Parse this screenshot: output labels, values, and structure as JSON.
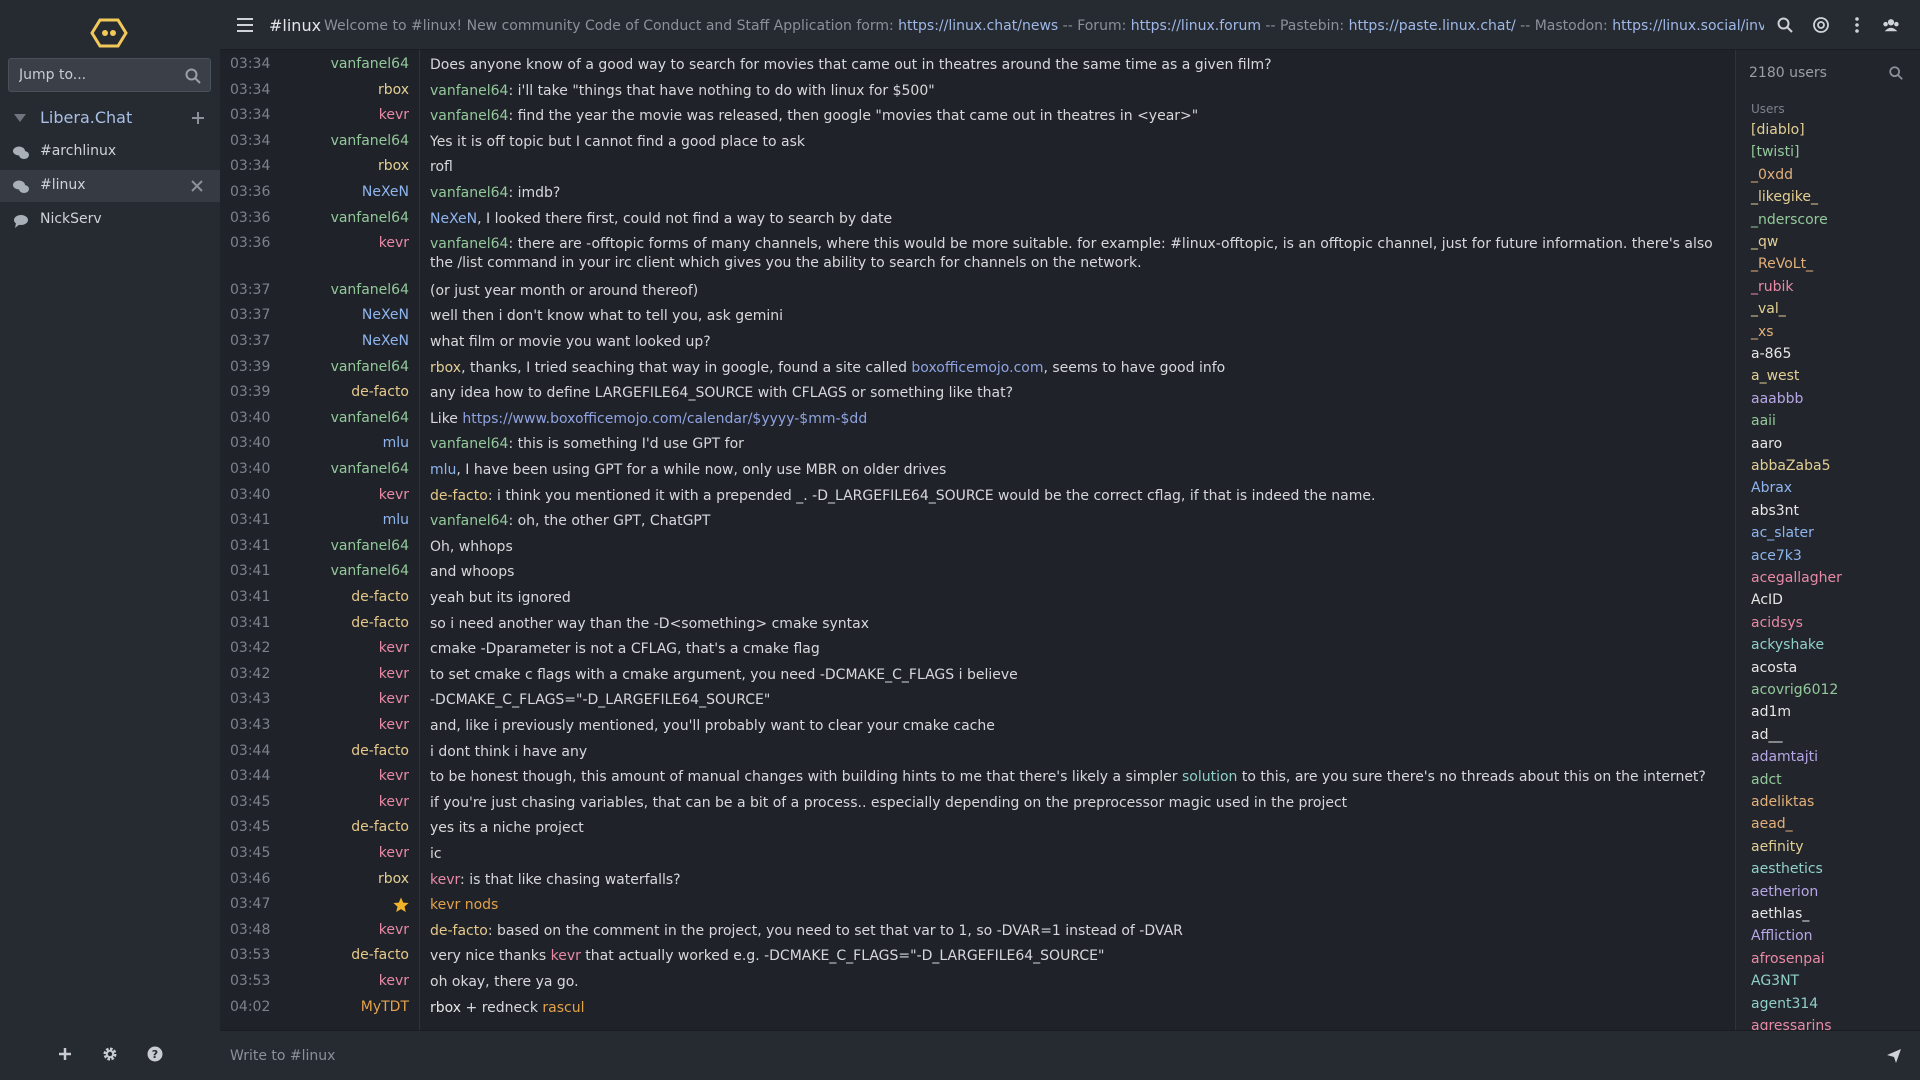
{
  "sidebar": {
    "jump_placeholder": "Jump to...",
    "network_name": "Libera.Chat",
    "channels": [
      {
        "label": "#archlinux"
      },
      {
        "label": "#linux",
        "active": true
      },
      {
        "label": "NickServ"
      }
    ]
  },
  "header": {
    "channel": "#linux",
    "topic_parts": [
      {
        "text": "Welcome to #linux! New community Code of Conduct and Staff Application form: ",
        "link": false
      },
      {
        "text": "https://linux.chat/news",
        "link": true
      },
      {
        "text": " -- Forum: ",
        "link": false
      },
      {
        "text": "https://linux.forum",
        "link": true
      },
      {
        "text": " -- Pastebin: ",
        "link": false
      },
      {
        "text": "https://paste.linux.chat/",
        "link": true
      },
      {
        "text": " -- Mastodon: ",
        "link": false
      },
      {
        "text": "https://linux.social/inv",
        "link": true
      }
    ]
  },
  "messages": [
    {
      "time": "03:34",
      "nick": "vanfanel64",
      "nc": "c-v",
      "parts": [
        {
          "text": "Does anyone know of a good way to search for movies that came out in theatres around the same time as a given film?"
        }
      ]
    },
    {
      "time": "03:34",
      "nick": "rbox",
      "nc": "c-r",
      "parts": [
        {
          "text": "vanfanel64",
          "c": "c-v"
        },
        {
          "text": ": i'll take \"things that have nothing to do with linux for $500\""
        }
      ]
    },
    {
      "time": "03:34",
      "nick": "kevr",
      "nc": "c-k",
      "parts": [
        {
          "text": "vanfanel64",
          "c": "c-v"
        },
        {
          "text": ": find the year the movie was released, then google \"movies that came out in theatres in <year>\""
        }
      ]
    },
    {
      "time": "03:34",
      "nick": "vanfanel64",
      "nc": "c-v",
      "parts": [
        {
          "text": "Yes it is off topic but I cannot find a good place to ask"
        }
      ]
    },
    {
      "time": "03:34",
      "nick": "rbox",
      "nc": "c-r",
      "parts": [
        {
          "text": "rofl"
        }
      ]
    },
    {
      "time": "03:36",
      "nick": "NeXeN",
      "nc": "c-n",
      "parts": [
        {
          "text": "vanfanel64",
          "c": "c-v"
        },
        {
          "text": ": imdb?"
        }
      ]
    },
    {
      "time": "03:36",
      "nick": "vanfanel64",
      "nc": "c-v",
      "parts": [
        {
          "text": "NeXeN",
          "c": "c-n"
        },
        {
          "text": ", I looked there first, could not find a way to search by date"
        }
      ]
    },
    {
      "time": "03:36",
      "nick": "kevr",
      "nc": "c-k",
      "lines": 2,
      "parts": [
        {
          "text": "vanfanel64",
          "c": "c-v"
        },
        {
          "text": ": there are -offtopic forms of many channels, where this would be more suitable. for example: #linux-offtopic, is an offtopic channel, just for future information. there's also the /list command in your irc client which gives you the ability to search for channels on the network."
        }
      ]
    },
    {
      "time": "03:37",
      "nick": "vanfanel64",
      "nc": "c-v",
      "parts": [
        {
          "text": "(or just year month or around thereof)"
        }
      ]
    },
    {
      "time": "03:37",
      "nick": "NeXeN",
      "nc": "c-n",
      "parts": [
        {
          "text": "well then i don't know what to tell you, ask gemini"
        }
      ]
    },
    {
      "time": "03:37",
      "nick": "NeXeN",
      "nc": "c-n",
      "parts": [
        {
          "text": "what film or movie you want looked up?"
        }
      ]
    },
    {
      "time": "03:39",
      "nick": "vanfanel64",
      "nc": "c-v",
      "parts": [
        {
          "text": "rbox",
          "c": "c-r"
        },
        {
          "text": ", thanks, I tried seaching that way in google, found a site called "
        },
        {
          "text": "boxofficemojo.com",
          "c": "link"
        },
        {
          "text": ", seems to have good info"
        }
      ]
    },
    {
      "time": "03:39",
      "nick": "de-facto",
      "nc": "c-d",
      "parts": [
        {
          "text": "any idea how to define LARGEFILE64_SOURCE with CFLAGS or something like that?"
        }
      ]
    },
    {
      "time": "03:40",
      "nick": "vanfanel64",
      "nc": "c-v",
      "parts": [
        {
          "text": "Like "
        },
        {
          "text": "https://www.boxofficemojo.com/calendar/$yyyy-$mm-$dd",
          "c": "link"
        }
      ]
    },
    {
      "time": "03:40",
      "nick": "mlu",
      "nc": "c-m",
      "parts": [
        {
          "text": "vanfanel64",
          "c": "c-v"
        },
        {
          "text": ": this is something I'd use GPT for"
        }
      ]
    },
    {
      "time": "03:40",
      "nick": "vanfanel64",
      "nc": "c-v",
      "parts": [
        {
          "text": "mlu",
          "c": "c-m"
        },
        {
          "text": ", I have been using GPT for a while now, only use MBR on older drives"
        }
      ]
    },
    {
      "time": "03:40",
      "nick": "kevr",
      "nc": "c-k",
      "parts": [
        {
          "text": "de-facto",
          "c": "c-d"
        },
        {
          "text": ": i think you mentioned it with a prepended _. -D_LARGEFILE64_SOURCE would be the correct cflag, if that is indeed the name."
        }
      ]
    },
    {
      "time": "03:41",
      "nick": "mlu",
      "nc": "c-m",
      "parts": [
        {
          "text": "vanfanel64",
          "c": "c-v"
        },
        {
          "text": ": oh, the other GPT, ChatGPT"
        }
      ]
    },
    {
      "time": "03:41",
      "nick": "vanfanel64",
      "nc": "c-v",
      "parts": [
        {
          "text": "Oh, whhops"
        }
      ]
    },
    {
      "time": "03:41",
      "nick": "vanfanel64",
      "nc": "c-v",
      "parts": [
        {
          "text": "and whoops"
        }
      ]
    },
    {
      "time": "03:41",
      "nick": "de-facto",
      "nc": "c-d",
      "parts": [
        {
          "text": "yeah but its ignored"
        }
      ]
    },
    {
      "time": "03:41",
      "nick": "de-facto",
      "nc": "c-d",
      "parts": [
        {
          "text": "so i need another way than the -D<something> cmake syntax"
        }
      ]
    },
    {
      "time": "03:42",
      "nick": "kevr",
      "nc": "c-k",
      "parts": [
        {
          "text": "cmake -Dparameter is not a CFLAG, that's a cmake flag"
        }
      ]
    },
    {
      "time": "03:42",
      "nick": "kevr",
      "nc": "c-k",
      "parts": [
        {
          "text": "to set cmake c flags with a cmake argument, you need -DCMAKE_C_FLAGS i believe"
        }
      ]
    },
    {
      "time": "03:43",
      "nick": "kevr",
      "nc": "c-k",
      "parts": [
        {
          "text": "-DCMAKE_C_FLAGS=\"-D_LARGEFILE64_SOURCE\""
        }
      ]
    },
    {
      "time": "03:43",
      "nick": "kevr",
      "nc": "c-k",
      "parts": [
        {
          "text": "and, like i previously mentioned, you'll probably want to clear your cmake cache"
        }
      ]
    },
    {
      "time": "03:44",
      "nick": "de-facto",
      "nc": "c-d",
      "parts": [
        {
          "text": "i dont think i have any"
        }
      ]
    },
    {
      "time": "03:44",
      "nick": "kevr",
      "nc": "c-k",
      "parts": [
        {
          "text": "to be honest though, this amount of manual changes with building hints to me that there's likely a simpler "
        },
        {
          "text": "solution",
          "c": "c-s"
        },
        {
          "text": " to this, are you sure there's no threads about this on the internet?"
        }
      ]
    },
    {
      "time": "03:45",
      "nick": "kevr",
      "nc": "c-k",
      "parts": [
        {
          "text": "if you're just chasing variables, that can be a bit of a process.. especially depending on the preprocessor magic used in the project"
        }
      ]
    },
    {
      "time": "03:45",
      "nick": "de-facto",
      "nc": "c-d",
      "parts": [
        {
          "text": "yes its a niche project"
        }
      ]
    },
    {
      "time": "03:45",
      "nick": "kevr",
      "nc": "c-k",
      "parts": [
        {
          "text": "ic"
        }
      ]
    },
    {
      "time": "03:46",
      "nick": "rbox",
      "nc": "c-r",
      "parts": [
        {
          "text": "kevr",
          "c": "c-k"
        },
        {
          "text": ": is that like chasing waterfalls?"
        }
      ]
    },
    {
      "time": "03:47",
      "nick": "",
      "nc": "c-o",
      "action": true,
      "parts": [
        {
          "text": "kevr nods",
          "c": "c-o"
        }
      ]
    },
    {
      "time": "03:48",
      "nick": "kevr",
      "nc": "c-k",
      "parts": [
        {
          "text": "de-facto",
          "c": "c-d"
        },
        {
          "text": ": based on the comment in the project, you need to set that var to 1, so -DVAR=1 instead of -DVAR"
        }
      ]
    },
    {
      "time": "03:53",
      "nick": "de-facto",
      "nc": "c-d",
      "parts": [
        {
          "text": "very nice thanks "
        },
        {
          "text": "kevr",
          "c": "c-k"
        },
        {
          "text": " that actually worked e.g. -DCMAKE_C_FLAGS=\"-D_LARGEFILE64_SOURCE\""
        }
      ]
    },
    {
      "time": "03:53",
      "nick": "kevr",
      "nc": "c-k",
      "parts": [
        {
          "text": "oh okay, there ya go."
        }
      ]
    },
    {
      "time": "04:02",
      "nick": "MyTDT",
      "nc": "c-o",
      "parts": [
        {
          "text": "rbox",
          "c": "c-w"
        },
        {
          "text": " + redneck "
        },
        {
          "text": "rascul",
          "c": "c-o"
        }
      ]
    }
  ],
  "userlist": {
    "count_label": "2180 users",
    "heading": "Users",
    "users": [
      {
        "n": "[diablo]",
        "c": "c-y"
      },
      {
        "n": "[twisti]",
        "c": "c-g"
      },
      {
        "n": "_0xdd",
        "c": "c-t"
      },
      {
        "n": "_likegike_",
        "c": "c-y"
      },
      {
        "n": "_nderscore",
        "c": "c-g"
      },
      {
        "n": "_qw",
        "c": "c-y"
      },
      {
        "n": "_ReVoLt_",
        "c": "c-t"
      },
      {
        "n": "_rubik",
        "c": "c-p"
      },
      {
        "n": "_val_",
        "c": "c-y"
      },
      {
        "n": "_xs",
        "c": "c-t"
      },
      {
        "n": "a-865",
        "c": "c-w"
      },
      {
        "n": "a_west",
        "c": "c-y"
      },
      {
        "n": "aaabbb",
        "c": "c-l"
      },
      {
        "n": "aaii",
        "c": "c-g"
      },
      {
        "n": "aaro",
        "c": "c-w"
      },
      {
        "n": "abbaZaba5",
        "c": "c-y"
      },
      {
        "n": "Abrax",
        "c": "c-b"
      },
      {
        "n": "abs3nt",
        "c": "c-w"
      },
      {
        "n": "ac_slater",
        "c": "c-b"
      },
      {
        "n": "ace7k3",
        "c": "c-b"
      },
      {
        "n": "acegallagher",
        "c": "c-p"
      },
      {
        "n": "AcID",
        "c": "c-w"
      },
      {
        "n": "acidsys",
        "c": "c-p"
      },
      {
        "n": "ackyshake",
        "c": "c-s"
      },
      {
        "n": "acosta",
        "c": "c-w"
      },
      {
        "n": "acovrig6012",
        "c": "c-g"
      },
      {
        "n": "ad1m",
        "c": "c-w"
      },
      {
        "n": "ad__",
        "c": "c-w"
      },
      {
        "n": "adamtajti",
        "c": "c-l"
      },
      {
        "n": "adct",
        "c": "c-g"
      },
      {
        "n": "adeliktas",
        "c": "c-t"
      },
      {
        "n": "aead_",
        "c": "c-t"
      },
      {
        "n": "aefinity",
        "c": "c-y"
      },
      {
        "n": "aesthetics",
        "c": "c-s"
      },
      {
        "n": "aetherion",
        "c": "c-l"
      },
      {
        "n": "aethlas_",
        "c": "c-w"
      },
      {
        "n": "Affliction",
        "c": "c-l"
      },
      {
        "n": "afrosenpai",
        "c": "c-p"
      },
      {
        "n": "AG3NT",
        "c": "c-s"
      },
      {
        "n": "agent314",
        "c": "c-s"
      },
      {
        "n": "agressarins",
        "c": "c-p"
      }
    ]
  },
  "input": {
    "placeholder": "Write to #linux"
  }
}
